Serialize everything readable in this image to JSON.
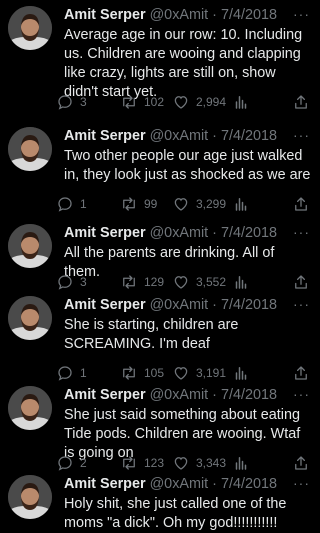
{
  "tweets": [
    {
      "name": "Amit Serper",
      "handle": "@0xAmit",
      "dot": "·",
      "date": "7/4/2018",
      "more": "···",
      "text": "Average age in our row: 10. Including us. Children are wooing and clapping like crazy, lights are still on, show didn't start yet.",
      "replies": "3",
      "retweets": "102",
      "likes": "2,994"
    },
    {
      "name": "Amit Serper",
      "handle": "@0xAmit",
      "dot": "·",
      "date": "7/4/2018",
      "more": "···",
      "text": "Two other people our age just walked in, they look just as shocked as we are",
      "replies": "1",
      "retweets": "99",
      "likes": "3,299"
    },
    {
      "name": "Amit Serper",
      "handle": "@0xAmit",
      "dot": "·",
      "date": "7/4/2018",
      "more": "···",
      "text": "All the parents are drinking. All of them.",
      "replies": "3",
      "retweets": "129",
      "likes": "3,552"
    },
    {
      "name": "Amit Serper",
      "handle": "@0xAmit",
      "dot": "·",
      "date": "7/4/2018",
      "more": "···",
      "text": "She is starting, children are SCREAMING. I'm deaf",
      "replies": "1",
      "retweets": "105",
      "likes": "3,191"
    },
    {
      "name": "Amit Serper",
      "handle": "@0xAmit",
      "dot": "·",
      "date": "7/4/2018",
      "more": "···",
      "text": "She just said something about eating Tide pods. Children are wooing. Wtaf is going on",
      "replies": "2",
      "retweets": "123",
      "likes": "3,343"
    },
    {
      "name": "Amit Serper",
      "handle": "@0xAmit",
      "dot": "·",
      "date": "7/4/2018",
      "more": "···",
      "text": "Holy shit, she just called one of the moms \"a dick\". Oh my god!!!!!!!!!!!"
    }
  ],
  "icons": {
    "reply": "reply-icon",
    "retweet": "retweet-icon",
    "like": "heart-icon",
    "views": "views-icon",
    "share": "share-icon"
  },
  "colors": {
    "background": "#000000",
    "text": "#e7e9ea",
    "muted": "#71767b"
  }
}
